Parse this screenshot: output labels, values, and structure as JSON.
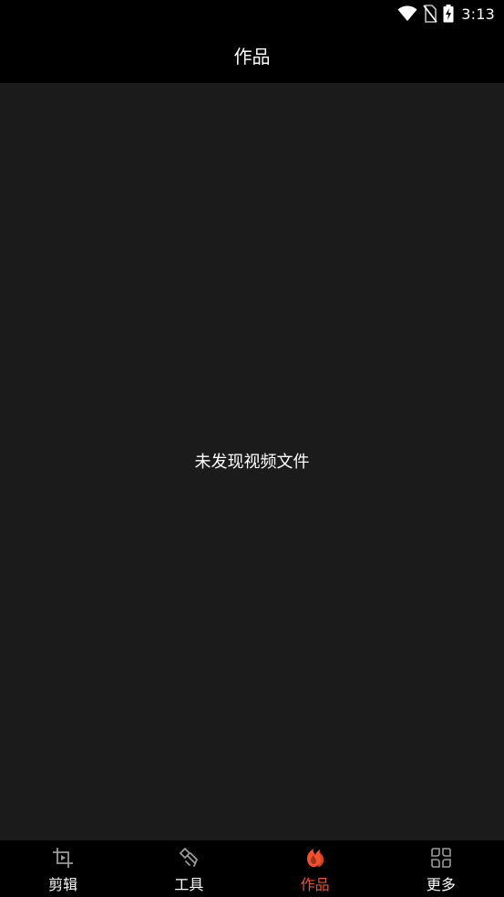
{
  "status_bar": {
    "time": "3:13",
    "icons": [
      "wifi-icon",
      "no-sim-icon",
      "battery-charging-icon"
    ]
  },
  "header": {
    "title": "作品"
  },
  "main": {
    "empty_message": "未发现视频文件"
  },
  "bottom_nav": {
    "active_index": 2,
    "items": [
      {
        "label": "剪辑",
        "icon": "crop-play-icon"
      },
      {
        "label": "工具",
        "icon": "tools-icon"
      },
      {
        "label": "作品",
        "icon": "works-flame-icon"
      },
      {
        "label": "更多",
        "icon": "more-grid-icon"
      }
    ]
  },
  "colors": {
    "accent": "#f4512c",
    "background": "#000000",
    "content_background": "#1b1b1b",
    "icon_inactive": "#9a9a9a"
  }
}
